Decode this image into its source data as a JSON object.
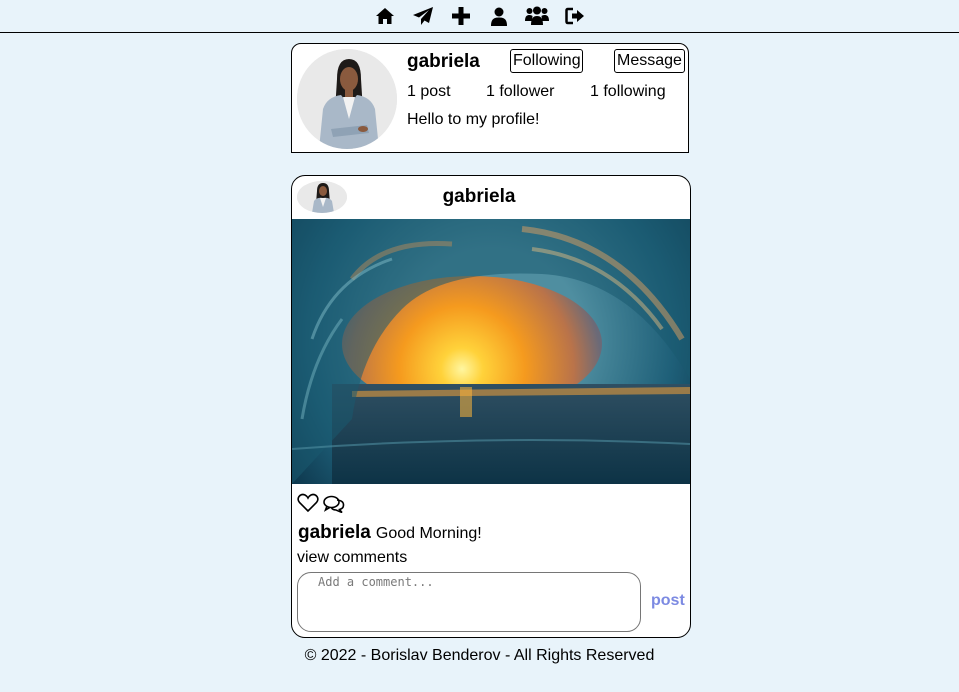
{
  "nav": {
    "icons": [
      "home-icon",
      "send-icon",
      "plus-icon",
      "user-icon",
      "users-icon",
      "sign-out-icon"
    ]
  },
  "profile": {
    "username": "gabriela",
    "following_label": "Following",
    "message_label": "Message",
    "posts": "1 post",
    "followers": "1 follower",
    "following": "1 following",
    "bio": "Hello to my profile!"
  },
  "post": {
    "author": "gabriela",
    "caption_user": "gabriela",
    "caption_text": "Good Morning!",
    "view_comments": "view comments",
    "comment_placeholder": "Add a comment...",
    "post_label": "post"
  },
  "footer": {
    "text": "© 2022 - Borislav Benderov - All Rights Reserved"
  },
  "colors": {
    "background": "#e8f3fa",
    "post_button": "#7c8ae2"
  }
}
